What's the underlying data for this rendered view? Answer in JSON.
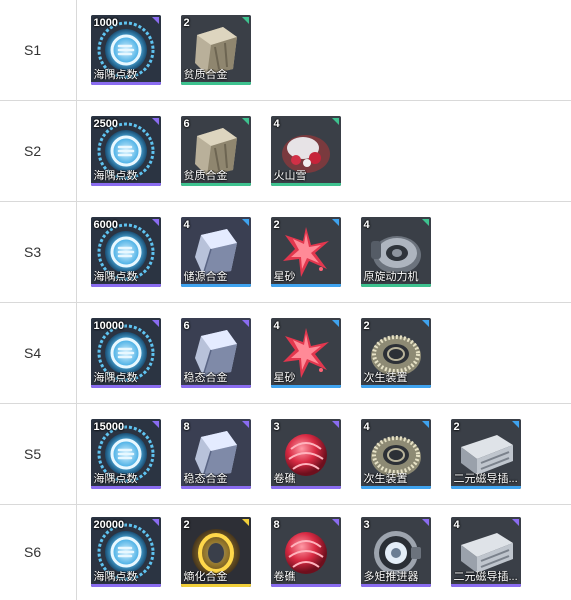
{
  "rarity_colors": {
    "purple": "#8a6cf0",
    "green": "#3ec28f",
    "blue": "#3fa3ef",
    "gold": "#f1cf3a"
  },
  "stages": [
    {
      "label": "S1",
      "items": [
        {
          "qty": "1000",
          "name": "海隅点数",
          "icon": "coin-emblem-icon",
          "rarity": "purple"
        },
        {
          "qty": "2",
          "name": "贫质合金",
          "icon": "alloy-ingot-icon",
          "rarity": "green"
        }
      ]
    },
    {
      "label": "S2",
      "items": [
        {
          "qty": "2500",
          "name": "海隅点数",
          "icon": "coin-emblem-icon",
          "rarity": "purple"
        },
        {
          "qty": "6",
          "name": "贫质合金",
          "icon": "alloy-ingot-icon",
          "rarity": "green"
        },
        {
          "qty": "4",
          "name": "火山雪",
          "icon": "volcanic-rock-icon",
          "rarity": "green"
        }
      ]
    },
    {
      "label": "S3",
      "items": [
        {
          "qty": "6000",
          "name": "海隅点数",
          "icon": "coin-emblem-icon",
          "rarity": "purple"
        },
        {
          "qty": "4",
          "name": "储源合金",
          "icon": "crystal-cube-icon",
          "rarity": "blue"
        },
        {
          "qty": "2",
          "name": "星砂",
          "icon": "star-sand-icon",
          "rarity": "blue"
        },
        {
          "qty": "4",
          "name": "原旋动力机",
          "icon": "turbine-icon",
          "rarity": "green"
        }
      ]
    },
    {
      "label": "S4",
      "items": [
        {
          "qty": "10000",
          "name": "海隅点数",
          "icon": "coin-emblem-icon",
          "rarity": "purple"
        },
        {
          "qty": "6",
          "name": "稳态合金",
          "icon": "crystal-cube-icon",
          "rarity": "purple"
        },
        {
          "qty": "4",
          "name": "星砂",
          "icon": "star-sand-icon",
          "rarity": "blue"
        },
        {
          "qty": "2",
          "name": "次生装置",
          "icon": "ring-device-icon",
          "rarity": "blue"
        }
      ]
    },
    {
      "label": "S5",
      "items": [
        {
          "qty": "15000",
          "name": "海隅点数",
          "icon": "coin-emblem-icon",
          "rarity": "purple"
        },
        {
          "qty": "8",
          "name": "稳态合金",
          "icon": "crystal-cube-icon",
          "rarity": "purple"
        },
        {
          "qty": "3",
          "name": "卷礁",
          "icon": "red-orb-icon",
          "rarity": "purple"
        },
        {
          "qty": "4",
          "name": "次生装置",
          "icon": "ring-device-icon",
          "rarity": "blue"
        },
        {
          "qty": "2",
          "name": "二元磁导插...",
          "icon": "battery-pack-icon",
          "rarity": "blue"
        }
      ]
    },
    {
      "label": "S6",
      "items": [
        {
          "qty": "20000",
          "name": "海隅点数",
          "icon": "coin-emblem-icon",
          "rarity": "purple"
        },
        {
          "qty": "2",
          "name": "熵化合金",
          "icon": "golden-core-icon",
          "rarity": "gold"
        },
        {
          "qty": "8",
          "name": "卷礁",
          "icon": "red-orb-icon",
          "rarity": "purple"
        },
        {
          "qty": "3",
          "name": "多矩推进器",
          "icon": "thruster-icon",
          "rarity": "purple"
        },
        {
          "qty": "4",
          "name": "二元磁导插...",
          "icon": "battery-pack-icon",
          "rarity": "purple"
        }
      ]
    }
  ]
}
